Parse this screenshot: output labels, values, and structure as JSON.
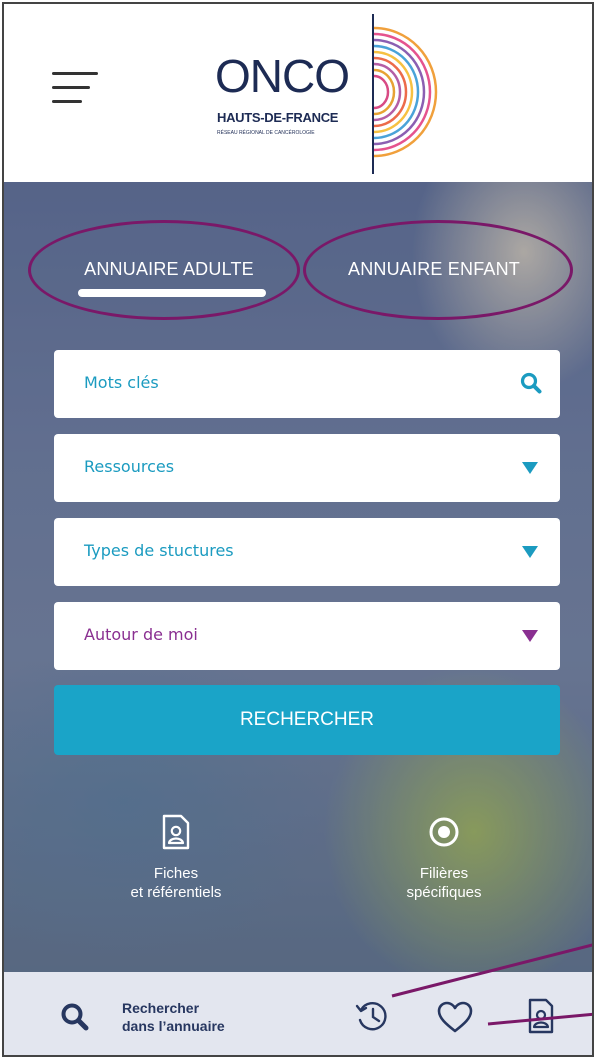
{
  "header": {
    "logo_word": "ONCO",
    "logo_sub": "HAUTS-DE-FRANCE",
    "logo_tag": "RÉSEAU RÉGIONAL DE CANCÉROLOGIE"
  },
  "tabs": [
    {
      "label": "ANNUAIRE ADULTE",
      "active": true
    },
    {
      "label": "ANNUAIRE ENFANT",
      "active": false
    }
  ],
  "search": {
    "keywords_placeholder": "Mots clés",
    "ressources_label": "Ressources",
    "types_label": "Types de stuctures",
    "autour_label": "Autour de moi",
    "submit_label": "RECHERCHER"
  },
  "quick_links": [
    {
      "line1": "Fiches",
      "line2": "et référentiels",
      "icon": "file-user-icon"
    },
    {
      "line1": "Filières",
      "line2": "spécifiques",
      "icon": "target-icon"
    }
  ],
  "bottom_bar": {
    "search_line1": "Rechercher",
    "search_line2": "dans l’annuaire",
    "icons": [
      "search-icon",
      "history-icon",
      "heart-icon",
      "file-user-icon"
    ]
  },
  "colors": {
    "accent": "#1aa4c8",
    "accent_text": "#1b9bc0",
    "purple": "#8a2f91",
    "annotation": "#7a1868",
    "brand_navy": "#1d2b54",
    "bottom_bar": "#e3e6ef"
  }
}
